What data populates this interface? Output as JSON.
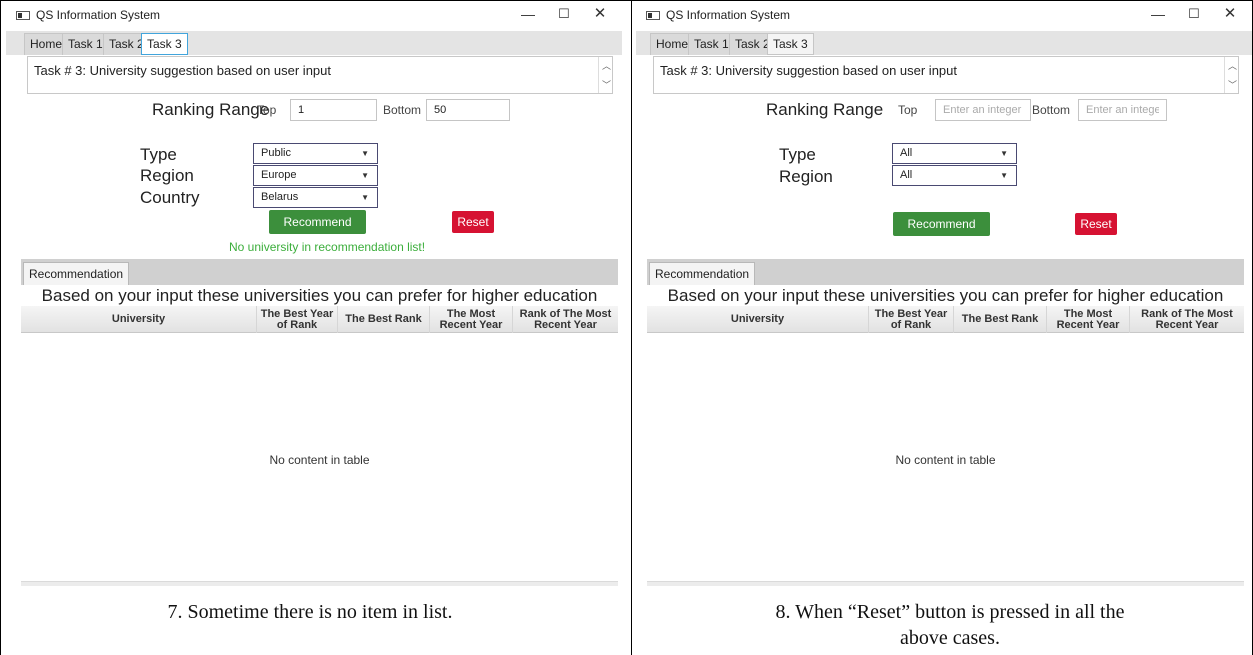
{
  "window": {
    "title": "QS Information System",
    "minimize_glyph": "—",
    "maximize_glyph": "☐",
    "close_glyph": "✕"
  },
  "tabs": [
    "Home",
    "Task 1",
    "Task 2",
    "Task 3"
  ],
  "task_description": "Task # 3: University suggestion based on user input",
  "form": {
    "ranking_range_label": "Ranking Range",
    "top_label": "Top",
    "bottom_label": "Bottom",
    "type_label": "Type",
    "region_label": "Region",
    "country_label": "Country",
    "recommend_label": "Recommend",
    "reset_label": "Reset"
  },
  "results": {
    "tab_label": "Recommendation",
    "heading": "Based on your input these universities you can prefer for higher education",
    "columns": [
      "University",
      "The Best Year of Rank",
      "The Best Rank",
      "The Most Recent Year",
      "Rank of The Most Recent Year"
    ],
    "empty_text": "No content in table"
  },
  "screen1": {
    "top_value": "1",
    "bottom_value": "50",
    "type_value": "Public",
    "region_value": "Europe",
    "country_value": "Belarus",
    "status_message": "No university in recommendation list!",
    "caption": "7.   Sometime there is no item in list."
  },
  "screen2": {
    "top_placeholder": "Enter an integer l",
    "bottom_placeholder": "Enter an integer",
    "type_value": "All",
    "region_value": "All",
    "caption_line1": "8.   When “Reset” button is pressed in all the",
    "caption_line2": "above cases."
  },
  "colors": {
    "recommend_button": "#3c8f3c",
    "reset_button": "#d61232",
    "status_message": "#3cae3c",
    "active_tab_border": "#42a5dc"
  }
}
